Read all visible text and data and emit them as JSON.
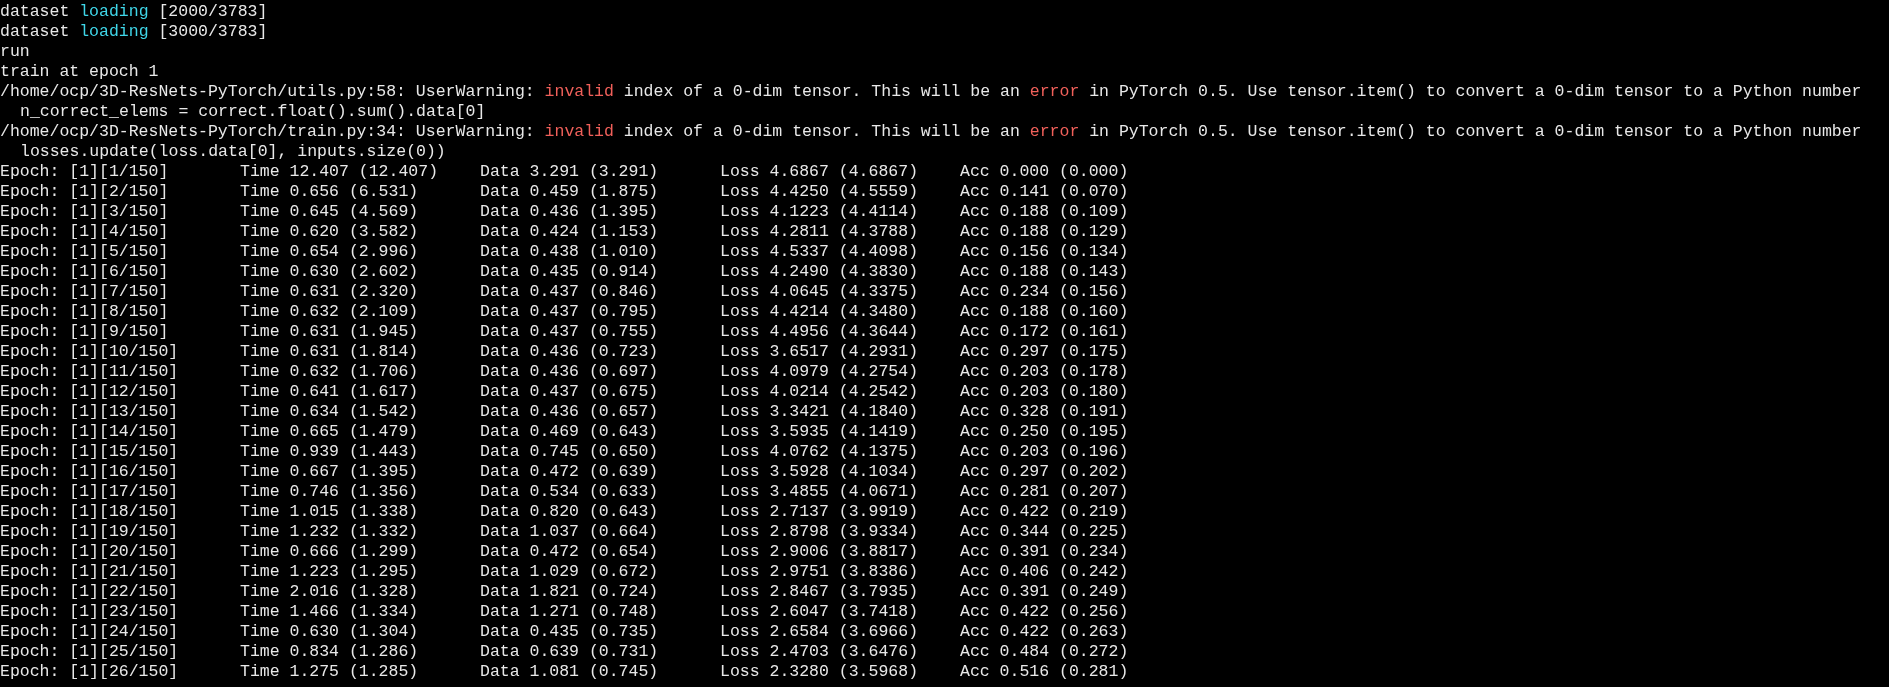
{
  "terminal": {
    "lines": [
      {
        "kind": "plain",
        "segments": [
          {
            "kind": "plain",
            "text": "dataset "
          },
          {
            "kind": "info",
            "text": "loading"
          },
          {
            "kind": "plain",
            "text": " [2000/3783]"
          }
        ]
      },
      {
        "kind": "plain",
        "segments": [
          {
            "kind": "plain",
            "text": "dataset "
          },
          {
            "kind": "info",
            "text": "loading"
          },
          {
            "kind": "plain",
            "text": " [3000/3783]"
          }
        ]
      },
      {
        "kind": "plain",
        "segments": [
          {
            "kind": "plain",
            "text": "run"
          }
        ]
      },
      {
        "kind": "plain",
        "segments": [
          {
            "kind": "plain",
            "text": "train at epoch 1"
          }
        ]
      },
      {
        "kind": "plain",
        "segments": [
          {
            "kind": "plain",
            "text": "/home/ocp/3D-ResNets-PyTorch/utils.py:58: UserWarning: "
          },
          {
            "kind": "error",
            "text": "invalid"
          },
          {
            "kind": "plain",
            "text": " index of a 0-dim tensor. This will be an "
          },
          {
            "kind": "error",
            "text": "error"
          },
          {
            "kind": "plain",
            "text": " in PyTorch 0.5. Use tensor.item() to convert a 0-dim tensor to a Python number"
          }
        ]
      },
      {
        "kind": "indented",
        "segments": [
          {
            "kind": "plain",
            "text": "n_correct_elems = correct.float().sum().data[0]"
          }
        ]
      },
      {
        "kind": "plain",
        "segments": [
          {
            "kind": "plain",
            "text": "/home/ocp/3D-ResNets-PyTorch/train.py:34: UserWarning: "
          },
          {
            "kind": "error",
            "text": "invalid"
          },
          {
            "kind": "plain",
            "text": " index of a 0-dim tensor. This will be an "
          },
          {
            "kind": "error",
            "text": "error"
          },
          {
            "kind": "plain",
            "text": " in PyTorch 0.5. Use tensor.item() to convert a 0-dim tensor to a Python number"
          }
        ]
      },
      {
        "kind": "indented",
        "segments": [
          {
            "kind": "plain",
            "text": "losses.update(loss.data[0], inputs.size(0))"
          }
        ]
      }
    ],
    "rows": [
      [
        "Epoch: [1][1/150]",
        "Time 12.407 (12.407)",
        "Data 3.291 (3.291)",
        "Loss 4.6867 (4.6867)",
        "Acc 0.000 (0.000)"
      ],
      [
        "Epoch: [1][2/150]",
        "Time 0.656 (6.531)",
        "Data 0.459 (1.875)",
        "Loss 4.4250 (4.5559)",
        "Acc 0.141 (0.070)"
      ],
      [
        "Epoch: [1][3/150]",
        "Time 0.645 (4.569)",
        "Data 0.436 (1.395)",
        "Loss 4.1223 (4.4114)",
        "Acc 0.188 (0.109)"
      ],
      [
        "Epoch: [1][4/150]",
        "Time 0.620 (3.582)",
        "Data 0.424 (1.153)",
        "Loss 4.2811 (4.3788)",
        "Acc 0.188 (0.129)"
      ],
      [
        "Epoch: [1][5/150]",
        "Time 0.654 (2.996)",
        "Data 0.438 (1.010)",
        "Loss 4.5337 (4.4098)",
        "Acc 0.156 (0.134)"
      ],
      [
        "Epoch: [1][6/150]",
        "Time 0.630 (2.602)",
        "Data 0.435 (0.914)",
        "Loss 4.2490 (4.3830)",
        "Acc 0.188 (0.143)"
      ],
      [
        "Epoch: [1][7/150]",
        "Time 0.631 (2.320)",
        "Data 0.437 (0.846)",
        "Loss 4.0645 (4.3375)",
        "Acc 0.234 (0.156)"
      ],
      [
        "Epoch: [1][8/150]",
        "Time 0.632 (2.109)",
        "Data 0.437 (0.795)",
        "Loss 4.4214 (4.3480)",
        "Acc 0.188 (0.160)"
      ],
      [
        "Epoch: [1][9/150]",
        "Time 0.631 (1.945)",
        "Data 0.437 (0.755)",
        "Loss 4.4956 (4.3644)",
        "Acc 0.172 (0.161)"
      ],
      [
        "Epoch: [1][10/150]",
        "Time 0.631 (1.814)",
        "Data 0.436 (0.723)",
        "Loss 3.6517 (4.2931)",
        "Acc 0.297 (0.175)"
      ],
      [
        "Epoch: [1][11/150]",
        "Time 0.632 (1.706)",
        "Data 0.436 (0.697)",
        "Loss 4.0979 (4.2754)",
        "Acc 0.203 (0.178)"
      ],
      [
        "Epoch: [1][12/150]",
        "Time 0.641 (1.617)",
        "Data 0.437 (0.675)",
        "Loss 4.0214 (4.2542)",
        "Acc 0.203 (0.180)"
      ],
      [
        "Epoch: [1][13/150]",
        "Time 0.634 (1.542)",
        "Data 0.436 (0.657)",
        "Loss 3.3421 (4.1840)",
        "Acc 0.328 (0.191)"
      ],
      [
        "Epoch: [1][14/150]",
        "Time 0.665 (1.479)",
        "Data 0.469 (0.643)",
        "Loss 3.5935 (4.1419)",
        "Acc 0.250 (0.195)"
      ],
      [
        "Epoch: [1][15/150]",
        "Time 0.939 (1.443)",
        "Data 0.745 (0.650)",
        "Loss 4.0762 (4.1375)",
        "Acc 0.203 (0.196)"
      ],
      [
        "Epoch: [1][16/150]",
        "Time 0.667 (1.395)",
        "Data 0.472 (0.639)",
        "Loss 3.5928 (4.1034)",
        "Acc 0.297 (0.202)"
      ],
      [
        "Epoch: [1][17/150]",
        "Time 0.746 (1.356)",
        "Data 0.534 (0.633)",
        "Loss 3.4855 (4.0671)",
        "Acc 0.281 (0.207)"
      ],
      [
        "Epoch: [1][18/150]",
        "Time 1.015 (1.338)",
        "Data 0.820 (0.643)",
        "Loss 2.7137 (3.9919)",
        "Acc 0.422 (0.219)"
      ],
      [
        "Epoch: [1][19/150]",
        "Time 1.232 (1.332)",
        "Data 1.037 (0.664)",
        "Loss 2.8798 (3.9334)",
        "Acc 0.344 (0.225)"
      ],
      [
        "Epoch: [1][20/150]",
        "Time 0.666 (1.299)",
        "Data 0.472 (0.654)",
        "Loss 2.9006 (3.8817)",
        "Acc 0.391 (0.234)"
      ],
      [
        "Epoch: [1][21/150]",
        "Time 1.223 (1.295)",
        "Data 1.029 (0.672)",
        "Loss 2.9751 (3.8386)",
        "Acc 0.406 (0.242)"
      ],
      [
        "Epoch: [1][22/150]",
        "Time 2.016 (1.328)",
        "Data 1.821 (0.724)",
        "Loss 2.8467 (3.7935)",
        "Acc 0.391 (0.249)"
      ],
      [
        "Epoch: [1][23/150]",
        "Time 1.466 (1.334)",
        "Data 1.271 (0.748)",
        "Loss 2.6047 (3.7418)",
        "Acc 0.422 (0.256)"
      ],
      [
        "Epoch: [1][24/150]",
        "Time 0.630 (1.304)",
        "Data 0.435 (0.735)",
        "Loss 2.6584 (3.6966)",
        "Acc 0.422 (0.263)"
      ],
      [
        "Epoch: [1][25/150]",
        "Time 0.834 (1.286)",
        "Data 0.639 (0.731)",
        "Loss 2.4703 (3.6476)",
        "Acc 0.484 (0.272)"
      ],
      [
        "Epoch: [1][26/150]",
        "Time 1.275 (1.285)",
        "Data 1.081 (0.745)",
        "Loss 2.3280 (3.5968)",
        "Acc 0.516 (0.281)"
      ]
    ]
  }
}
